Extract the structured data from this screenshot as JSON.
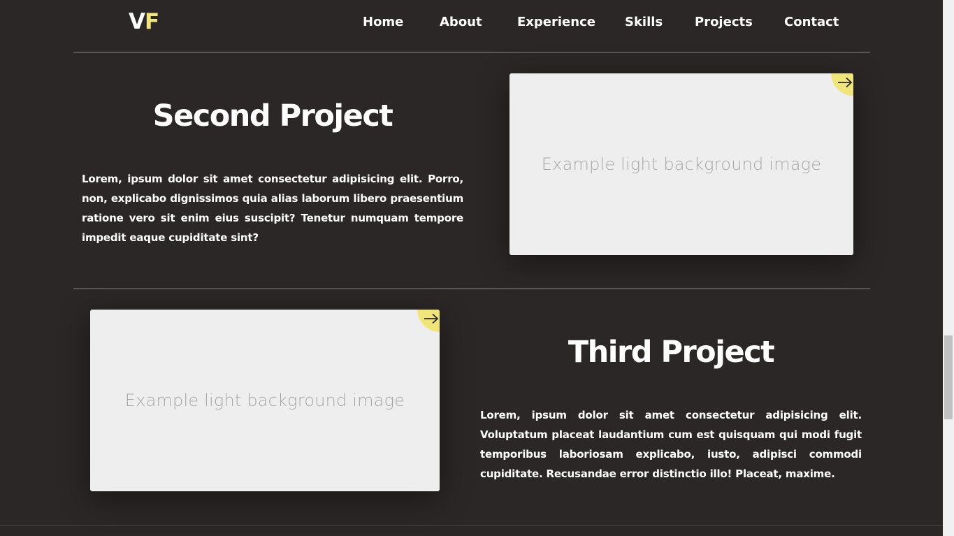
{
  "header": {
    "logo_v": "V",
    "logo_f": "F",
    "nav": [
      "Home",
      "About",
      "Experience",
      "Skills",
      "Projects",
      "Contact"
    ]
  },
  "projects": [
    {
      "title": "Second Project",
      "description": "Lorem, ipsum dolor sit amet consectetur adipisicing elit. Porro, non, explicabo dignissimos quia alias laborum libero praesentium ratione vero sit enim eius suscipit? Tenetur numquam tempore impedit eaque cupiditate sint?",
      "image_label": "Example light background image",
      "link_icon": "arrow-right-icon"
    },
    {
      "title": "Third Project",
      "description": "Lorem, ipsum dolor sit amet consectetur adipisicing elit. Voluptatum placeat laudantium cum est quisquam qui modi fugit temporibus laboriosam explicabo, iusto, adipisci commodi cupiditate. Recusandae error distinctio illo! Placeat, maxime.",
      "image_label": "Example light background image",
      "link_icon": "arrow-right-icon"
    }
  ],
  "colors": {
    "background": "#2b2726",
    "accent": "#f0e57a",
    "card": "#eeeeee",
    "text": "#ffffff"
  }
}
